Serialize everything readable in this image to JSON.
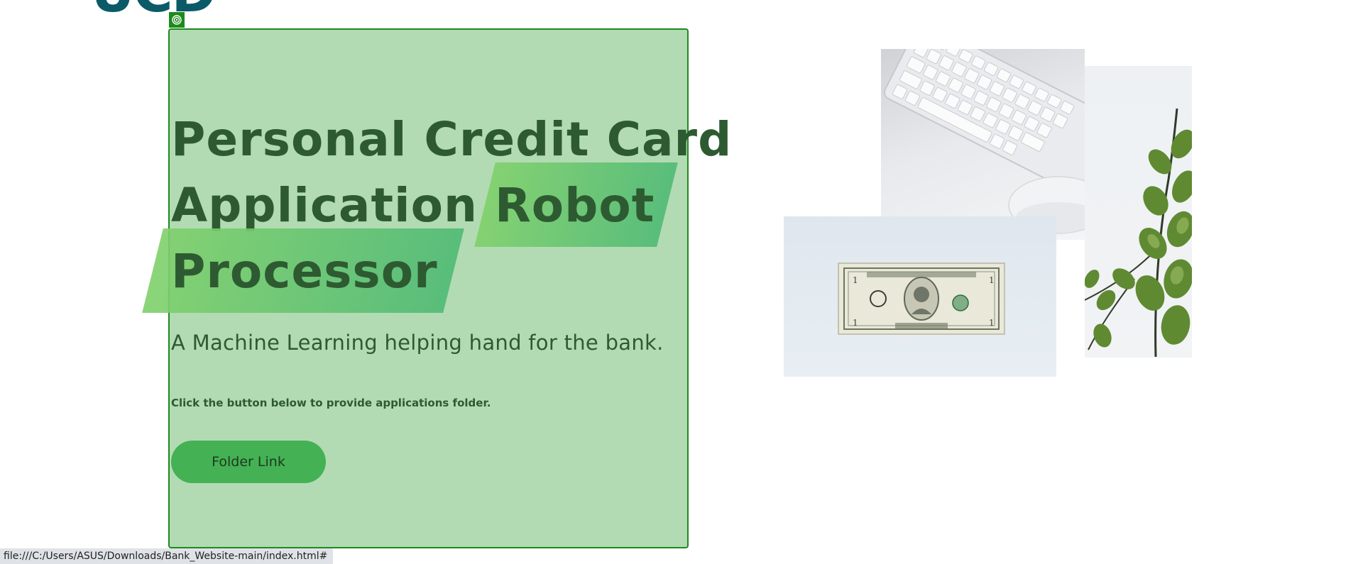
{
  "logo": {
    "text": "UCD"
  },
  "hero": {
    "title_line1": "Personal Credit Card",
    "title_line2_plain": "Application",
    "title_line2_highlight": "Robot",
    "title_line3_highlight": "Processor",
    "subtitle": "A Machine Learning helping hand for the bank.",
    "note": "Click the button below to provide applications folder.",
    "button_label": "Folder Link"
  },
  "images": {
    "keyboard": "keyboard-and-mouse-photo",
    "leaf": "eucalyptus-leaf-photo",
    "dollar": "one-dollar-bill-photo"
  },
  "status_bar": {
    "url": "file:///C:/Users/ASUS/Downloads/Bank_Website-main/index.html#"
  },
  "colors": {
    "title": "#2e5a31",
    "highlight_start": "#7fd06b",
    "highlight_end": "#4fba75",
    "button": "#44b154",
    "inspector_overlay": "#56b056",
    "logo": "#0b5a67"
  }
}
